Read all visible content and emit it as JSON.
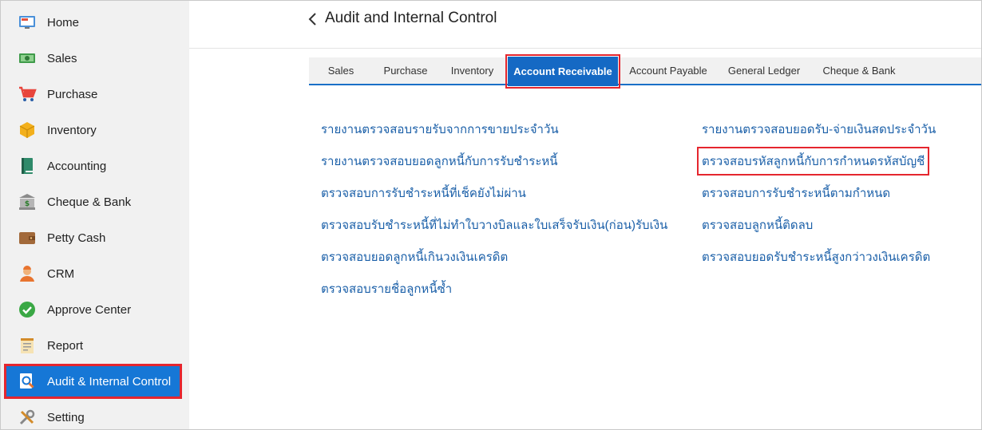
{
  "sidebar": {
    "items": [
      {
        "label": "Home",
        "icon": "monitor-icon"
      },
      {
        "label": "Sales",
        "icon": "cash-icon"
      },
      {
        "label": "Purchase",
        "icon": "cart-icon"
      },
      {
        "label": "Inventory",
        "icon": "box-icon"
      },
      {
        "label": "Accounting",
        "icon": "ledger-book-icon"
      },
      {
        "label": "Cheque & Bank",
        "icon": "bank-icon"
      },
      {
        "label": "Petty Cash",
        "icon": "wallet-icon"
      },
      {
        "label": "CRM",
        "icon": "customer-icon"
      },
      {
        "label": "Approve Center",
        "icon": "check-circle-icon"
      },
      {
        "label": "Report",
        "icon": "report-icon"
      },
      {
        "label": "Audit & Internal Control",
        "icon": "audit-search-icon",
        "active": true
      },
      {
        "label": "Setting",
        "icon": "tools-icon"
      }
    ]
  },
  "header": {
    "title": "Audit and Internal Control"
  },
  "tabs": [
    {
      "label": "Sales"
    },
    {
      "label": "Purchase"
    },
    {
      "label": "Inventory"
    },
    {
      "label": "Account Receivable",
      "active": true
    },
    {
      "label": "Account Payable"
    },
    {
      "label": "General Ledger"
    },
    {
      "label": "Cheque & Bank"
    }
  ],
  "reports": {
    "left": [
      "รายงานตรวจสอบรายรับจากการขายประจำวัน",
      "รายงานตรวจสอบยอดลูกหนี้กับการรับชำระหนี้",
      "ตรวจสอบการรับชำระหนี้ที่เช็คยังไม่ผ่าน",
      "ตรวจสอบรับชำระหนี้ที่ไม่ทำใบวางบิลและใบเสร็จรับเงิน(ก่อน)รับเงิน",
      "ตรวจสอบยอดลูกหนี้เกินวงเงินเครดิต",
      "ตรวจสอบรายชื่อลูกหนี้ซ้ำ"
    ],
    "right": [
      "รายงานตรวจสอบยอดรับ-จ่ายเงินสดประจำวัน",
      "ตรวจสอบรหัสลูกหนี้กับการกำหนดรหัสบัญชี",
      "ตรวจสอบการรับชำระหนี้ตามกำหนด",
      "ตรวจสอบลูกหนี้ติดลบ",
      "ตรวจสอบยอดรับชำระหนี้สูงกว่าวงเงินเครดิต"
    ],
    "highlighted": "ตรวจสอบรหัสลูกหนี้กับการกำหนดรหัสบัญชี"
  },
  "colors": {
    "accent": "#1677d6",
    "tab_active": "#1569c4",
    "link": "#1a5fa8",
    "highlight_border": "#e5262e",
    "sidebar_bg": "#f1f1f1"
  }
}
